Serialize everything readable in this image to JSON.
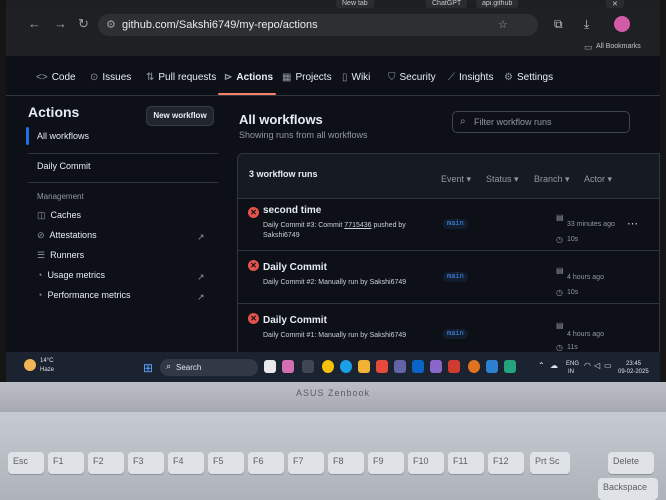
{
  "browser": {
    "tabs": [
      "New tab",
      "ChatGPT",
      "api.github"
    ],
    "url": "github.com/Sakshi6749/my-repo/actions",
    "bookmarks_label": "All Bookmarks"
  },
  "repo_nav": {
    "items": [
      {
        "label": "Code",
        "icon": "code-icon"
      },
      {
        "label": "Issues",
        "icon": "issues-icon"
      },
      {
        "label": "Pull requests",
        "icon": "pull-request-icon"
      },
      {
        "label": "Actions",
        "icon": "play-icon",
        "active": true
      },
      {
        "label": "Projects",
        "icon": "table-icon"
      },
      {
        "label": "Wiki",
        "icon": "book-icon"
      },
      {
        "label": "Security",
        "icon": "shield-icon"
      },
      {
        "label": "Insights",
        "icon": "graph-icon"
      },
      {
        "label": "Settings",
        "icon": "gear-icon"
      }
    ]
  },
  "sidebar": {
    "title": "Actions",
    "new_workflow": "New workflow",
    "all_workflows": "All workflows",
    "workflows": [
      "Daily Commit"
    ],
    "section": "Management",
    "management": [
      {
        "label": "Caches",
        "icon": "database-icon",
        "external": false
      },
      {
        "label": "Attestations",
        "icon": "check-circle-icon",
        "external": true
      },
      {
        "label": "Runners",
        "icon": "server-icon",
        "external": false
      },
      {
        "label": "Usage metrics",
        "icon": "gauge-icon",
        "external": true
      },
      {
        "label": "Performance metrics",
        "icon": "gauge-icon",
        "external": true
      }
    ]
  },
  "main": {
    "title": "All workflows",
    "subtitle": "Showing runs from all workflows",
    "filter_placeholder": "Filter workflow runs",
    "runs_count": "3 workflow runs",
    "filters": [
      "Event",
      "Status",
      "Branch",
      "Actor"
    ],
    "runs": [
      {
        "title": "second time",
        "desc_prefix": "Daily Commit #3: Commit ",
        "commit": "7715436",
        "desc_suffix": " pushed by Sakshi6749",
        "branch": "main",
        "time": "33 minutes ago",
        "duration": "10s",
        "status": "failure"
      },
      {
        "title": "Daily Commit",
        "desc_prefix": "Daily Commit #2: Manually run by Sakshi6749",
        "commit": "",
        "desc_suffix": "",
        "branch": "main",
        "time": "4 hours ago",
        "duration": "10s",
        "status": "failure"
      },
      {
        "title": "Daily Commit",
        "desc_prefix": "Daily Commit #1: Manually run by Sakshi6749",
        "commit": "",
        "desc_suffix": "",
        "branch": "main",
        "time": "4 hours ago",
        "duration": "11s",
        "status": "failure"
      }
    ]
  },
  "taskbar": {
    "weather_temp": "14°C",
    "weather_desc": "Haze",
    "search": "Search",
    "lang_line1": "ENG",
    "lang_line2": "IN",
    "clock_time": "23:45",
    "clock_date": "09-02-2025"
  },
  "laptop": {
    "brand": "ASUS Zenbook",
    "keys": [
      "Esc",
      "F1",
      "F2",
      "F3",
      "F4",
      "F5",
      "F6",
      "F7",
      "F8",
      "F9",
      "F10",
      "F11",
      "F12",
      "Prt Sc",
      "Delete",
      "Backspace"
    ]
  },
  "colors": {
    "accent": "#f78166",
    "link": "#4493f8",
    "failure": "#e5534b",
    "background": "#0d1117"
  }
}
